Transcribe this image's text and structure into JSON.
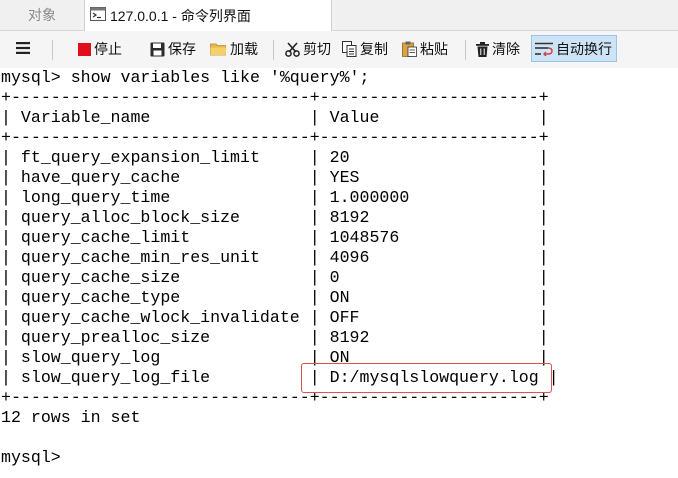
{
  "tabs": {
    "objects_label": "对象",
    "active_label": "127.0.0.1 - 命令列界面",
    "active_icon": "console-icon"
  },
  "toolbar": {
    "menu_icon": "hamburger-menu-icon",
    "stop_label": "停止",
    "save_label": "保存",
    "load_label": "加载",
    "cut_label": "剪切",
    "copy_label": "复制",
    "paste_label": "粘贴",
    "clear_label": "清除",
    "wrap_label": "自动换行",
    "wrap_active": true,
    "stop_color": "#e0101b"
  },
  "console": {
    "lines": [
      "mysql> show variables like '%query%';",
      "+------------------------------+----------------------+",
      "| Variable_name                | Value                |",
      "+------------------------------+----------------------+",
      "| ft_query_expansion_limit     | 20                   |",
      "| have_query_cache             | YES                  |",
      "| long_query_time              | 1.000000             |",
      "| query_alloc_block_size       | 8192                 |",
      "| query_cache_limit            | 1048576              |",
      "| query_cache_min_res_unit     | 4096                 |",
      "| query_cache_size             | 0                    |",
      "| query_cache_type             | ON                   |",
      "| query_cache_wlock_invalidate | OFF                  |",
      "| query_prealloc_size          | 8192                 |",
      "| slow_query_log               | ON                   |",
      "| slow_query_log_file          | D:/mysqlslowquery.log |",
      "+------------------------------+----------------------+",
      "12 rows in set",
      "",
      "mysql>"
    ],
    "highlight_color": "#d9534f"
  }
}
